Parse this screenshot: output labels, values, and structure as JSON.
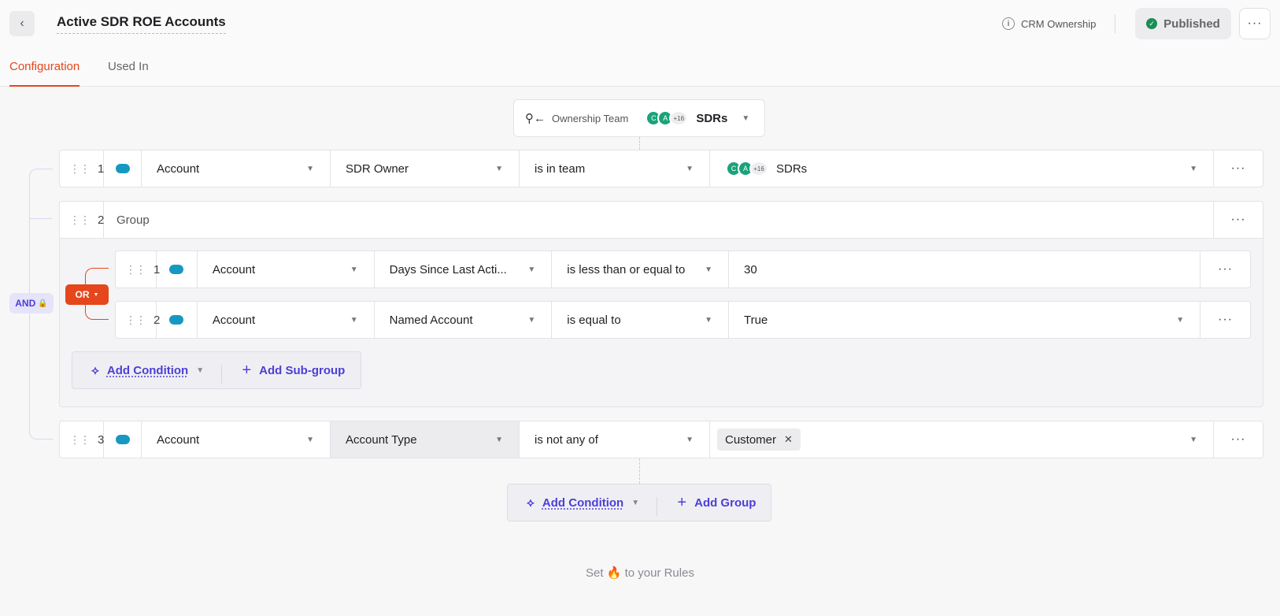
{
  "header": {
    "title": "Active SDR ROE Accounts",
    "crm_label": "CRM Ownership",
    "status_label": "Published",
    "more_label": "···"
  },
  "tabs": [
    {
      "label": "Configuration",
      "active": true
    },
    {
      "label": "Used In",
      "active": false
    }
  ],
  "ownership_team": {
    "label": "Ownership Team",
    "avatars": [
      "C",
      "A"
    ],
    "more_count": "+16",
    "team": "SDRs"
  },
  "logic": {
    "operator": "AND"
  },
  "rules": {
    "r1": {
      "index": "1",
      "object": "Account",
      "field": "SDR Owner",
      "operator": "is in team",
      "value_avatars": [
        "C",
        "A"
      ],
      "value_more": "+16",
      "value": "SDRs"
    },
    "r2": {
      "index": "2",
      "label": "Group",
      "group_operator": "OR",
      "c1": {
        "index": "1",
        "object": "Account",
        "field": "Days Since Last Acti...",
        "operator": "is less than or equal to",
        "value": "30"
      },
      "c2": {
        "index": "2",
        "object": "Account",
        "field": "Named Account",
        "operator": "is equal to",
        "value": "True"
      },
      "add_condition": "Add Condition",
      "add_subgroup": "Add Sub-group"
    },
    "r3": {
      "index": "3",
      "object": "Account",
      "field": "Account Type",
      "operator": "is not any of",
      "chip": "Customer"
    }
  },
  "bottom_actions": {
    "add_condition": "Add Condition",
    "add_group": "Add Group"
  },
  "footer": {
    "pre": "Set",
    "emoji": "🔥",
    "post": "to your Rules"
  },
  "colors": {
    "accent": "#e6461b",
    "link": "#4b3fd6",
    "and_bg": "#e5e4fa",
    "salesforce": "#1798c1",
    "avatar": "#1aa37a"
  }
}
